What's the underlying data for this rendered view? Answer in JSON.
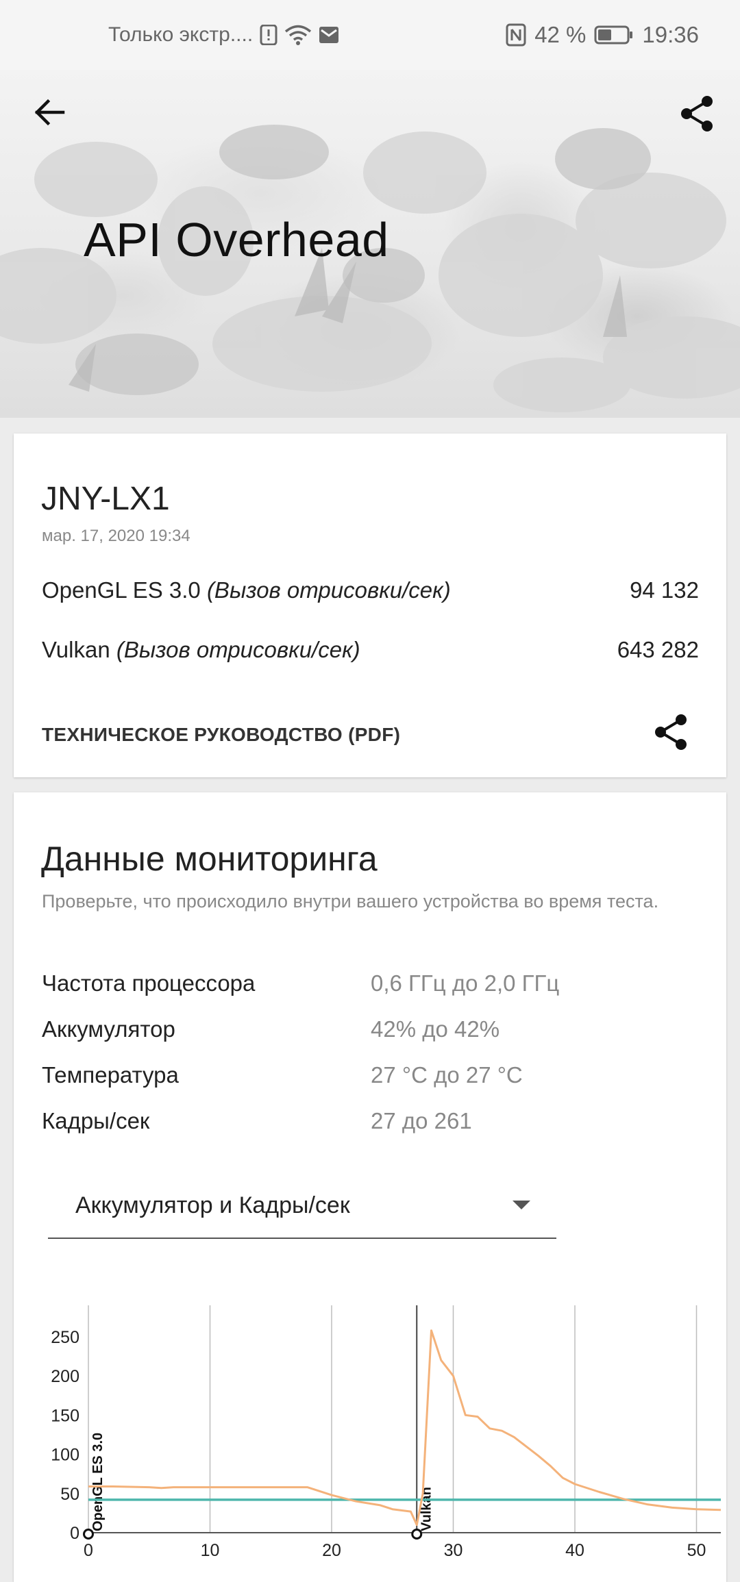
{
  "status_bar": {
    "notification_text": "Только экстр....",
    "battery_percent": "42 %",
    "time": "19:36",
    "icons": [
      "alert-icon",
      "wifi-icon",
      "mail-icon",
      "nfc-icon",
      "battery-icon"
    ]
  },
  "header": {
    "title": "API Overhead",
    "back_icon": "back-arrow-icon",
    "share_icon": "share-icon"
  },
  "result": {
    "device": "JNY-LX1",
    "date": "мар. 17, 2020 19:34",
    "scores": [
      {
        "name": "OpenGL ES 3.0",
        "unit": "(Вызов отрисовки/сек)",
        "value": "94 132"
      },
      {
        "name": "Vulkan",
        "unit": "(Вызов отрисовки/сек)",
        "value": "643 282"
      }
    ],
    "guide_label": "ТЕХНИЧЕСКОЕ РУКОВОДСТВО (PDF)"
  },
  "monitoring": {
    "title": "Данные мониторинга",
    "subtitle": "Проверьте, что происходило внутри вашего устройства во время теста.",
    "rows": [
      {
        "key": "Частота процессора",
        "value": "0,6 ГГц до 2,0 ГГц"
      },
      {
        "key": "Аккумулятор",
        "value": "42% до 42%"
      },
      {
        "key": "Температура",
        "value": "27 °C до 27 °C"
      },
      {
        "key": "Кадры/сек",
        "value": "27 до 261"
      }
    ],
    "dropdown_value": "Аккумулятор и Кадры/сек"
  },
  "chart_data": {
    "type": "line",
    "xlim": [
      0,
      52
    ],
    "ylim": [
      0,
      270
    ],
    "x_ticks": [
      0,
      10,
      20,
      30,
      40,
      50
    ],
    "y_ticks": [
      0,
      50,
      100,
      150,
      200,
      250
    ],
    "grid": "vertical",
    "markers": [
      {
        "x": 0,
        "label": "OpenGL ES 3.0"
      },
      {
        "x": 27,
        "label": "Vulkan"
      }
    ],
    "series": [
      {
        "color": "#4db6ac",
        "x": [
          0,
          52
        ],
        "y": [
          42,
          42
        ]
      },
      {
        "color": "#f4b27a",
        "x": [
          0,
          2,
          5,
          6,
          7,
          10,
          12,
          15,
          18,
          20,
          22,
          24,
          25,
          26.5,
          27,
          27.5,
          28.2,
          29,
          30,
          31,
          32,
          33,
          34,
          35,
          36,
          37,
          38,
          39,
          40,
          42,
          44,
          46,
          48,
          50,
          52
        ],
        "y": [
          59,
          59,
          58,
          57,
          58,
          58,
          58,
          58,
          58,
          48,
          40,
          35,
          30,
          27,
          10,
          50,
          258,
          220,
          200,
          150,
          148,
          133,
          130,
          122,
          110,
          98,
          85,
          70,
          62,
          52,
          43,
          36,
          32,
          30,
          29
        ]
      }
    ]
  }
}
